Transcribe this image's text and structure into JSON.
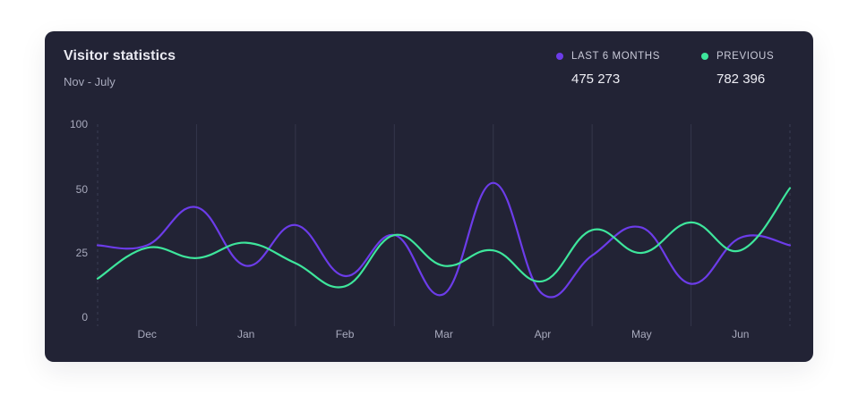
{
  "card": {
    "title": "Visitor statistics",
    "subtitle": "Nov - July"
  },
  "legend": [
    {
      "label": "LAST 6 MONTHS",
      "value": "475 273",
      "color": "#6c3ce9"
    },
    {
      "label": "PREVIOUS",
      "value": "782 396",
      "color": "#3ee69c"
    }
  ],
  "chart_data": {
    "type": "line",
    "smooth": true,
    "categories": [
      "Dec",
      "Jan",
      "Feb",
      "Mar",
      "Apr",
      "May",
      "Jun"
    ],
    "y_ticks": [
      0,
      25,
      50,
      100
    ],
    "grid": "vertical",
    "background": "#222335",
    "series": [
      {
        "name": "LAST 6 MONTHS",
        "color": "#6c3ce9",
        "points": [
          [
            0.0,
            28
          ],
          [
            0.5,
            28
          ],
          [
            1.0,
            43
          ],
          [
            1.5,
            20
          ],
          [
            2.0,
            36
          ],
          [
            2.5,
            16
          ],
          [
            3.0,
            32
          ],
          [
            3.5,
            9
          ],
          [
            4.0,
            55
          ],
          [
            4.5,
            9
          ],
          [
            5.0,
            24
          ],
          [
            5.5,
            35
          ],
          [
            6.0,
            13
          ],
          [
            6.5,
            31
          ],
          [
            7.0,
            28
          ]
        ]
      },
      {
        "name": "PREVIOUS",
        "color": "#3ee69c",
        "points": [
          [
            0.0,
            15
          ],
          [
            0.5,
            27
          ],
          [
            1.0,
            23
          ],
          [
            1.5,
            29
          ],
          [
            2.0,
            21
          ],
          [
            2.5,
            12
          ],
          [
            3.0,
            32
          ],
          [
            3.5,
            20
          ],
          [
            4.0,
            26
          ],
          [
            4.5,
            14
          ],
          [
            5.0,
            34
          ],
          [
            5.5,
            25
          ],
          [
            6.0,
            37
          ],
          [
            6.5,
            26
          ],
          [
            7.0,
            51
          ]
        ]
      }
    ]
  }
}
